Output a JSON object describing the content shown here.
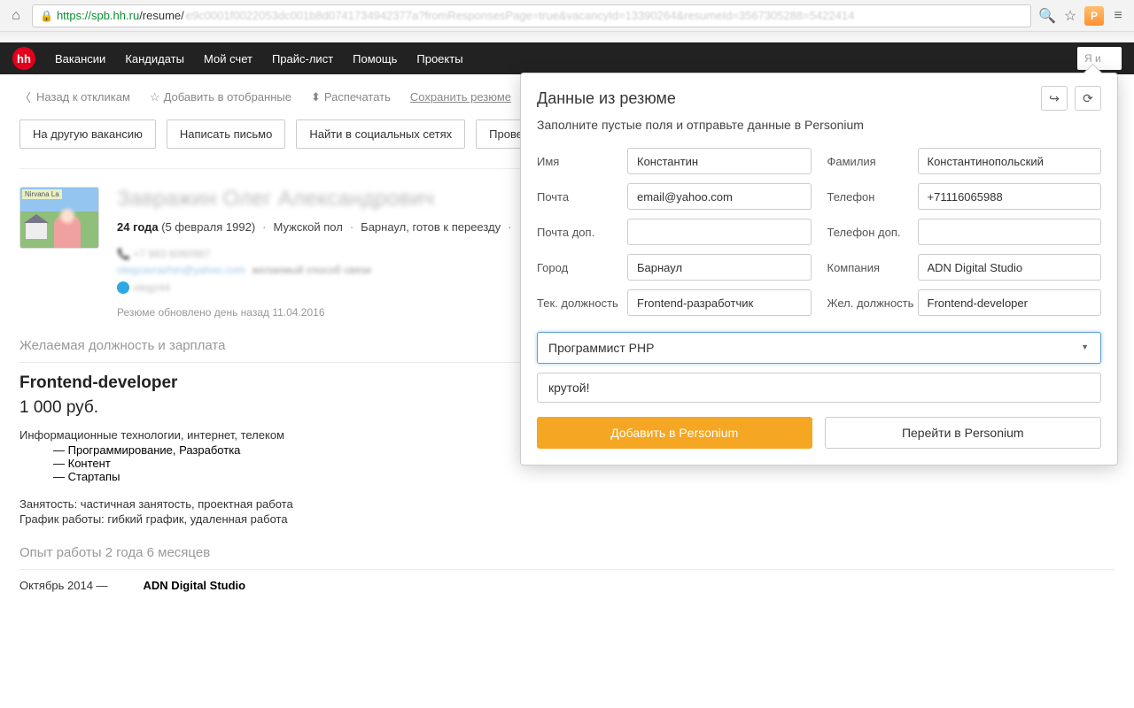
{
  "chrome": {
    "url_green": "https://spb.hh.ru",
    "url_rest": "/resume/",
    "url_blur": "e9c0001f0022053dc001b8d0741734942377a?fromResponsesPage=true&vacancyId=13390264&resumeId=3567305288=5422414",
    "ext_letter": "P"
  },
  "hh": {
    "nav": [
      "Вакансии",
      "Кандидаты",
      "Мой счет",
      "Прайс-лист",
      "Помощь",
      "Проекты"
    ],
    "search_placeholder": "Я и"
  },
  "crumbs": {
    "back": "Назад к откликам",
    "fav": "Добавить в отобранные",
    "print": "Распечатать",
    "save": "Сохранить резюме"
  },
  "actions": [
    "На другую вакансию",
    "Написать письмо",
    "Найти в социальных сетях",
    "Провес"
  ],
  "resume": {
    "name_blur": "Завражин Олег Александрович",
    "age": "24 года",
    "dob": "(5 февраля 1992)",
    "gender": "Мужской пол",
    "city": "Барнаул, готов к переезду",
    "phone_blur": "+7 983 6060987",
    "email_blur": "olegzavrazhin@yahoo.com",
    "pref": "желаемый способ связи",
    "skype_blur": "olegz44",
    "updated": "Резюме обновлено день назад  11.04.2016",
    "avatar_tag": "Nirvana La"
  },
  "job": {
    "section_title": "Желаемая должность и зарплата",
    "position": "Frontend-developer",
    "salary": "1 000 руб.",
    "category_line": "Информационные технологии, интернет, телеком",
    "categories": [
      "Программирование, Разработка",
      "Контент",
      "Стартапы"
    ],
    "employment": "Занятость: частичная занятость, проектная работа",
    "schedule": "График работы: гибкий график, удаленная работа"
  },
  "exp": {
    "section_title": "Опыт работы 2 года 6 месяцев",
    "date": "Октябрь 2014 —",
    "company": "ADN Digital Studio"
  },
  "popup": {
    "title": "Данные из резюме",
    "subtitle": "Заполните пустые поля и отправьте данные в Personium",
    "labels": {
      "first_name": "Имя",
      "last_name": "Фамилия",
      "email": "Почта",
      "phone": "Телефон",
      "email2": "Почта доп.",
      "phone2": "Телефон доп.",
      "city": "Город",
      "company": "Компания",
      "cur_pos": "Тек. должность",
      "des_pos": "Жел. должность"
    },
    "values": {
      "first_name": "Константин",
      "last_name": "Константинопольский",
      "email": "email@yahoo.com",
      "phone": "+71116065988",
      "email2": "",
      "phone2": "",
      "city": "Барнаул",
      "company": "ADN Digital Studio",
      "cur_pos": "Frontend-разработчик",
      "des_pos": "Frontend-developer"
    },
    "vacancy": "Программист PHP",
    "note": "крутой!",
    "add_btn": "Добавить в Personium",
    "goto_btn": "Перейти в Personium"
  }
}
